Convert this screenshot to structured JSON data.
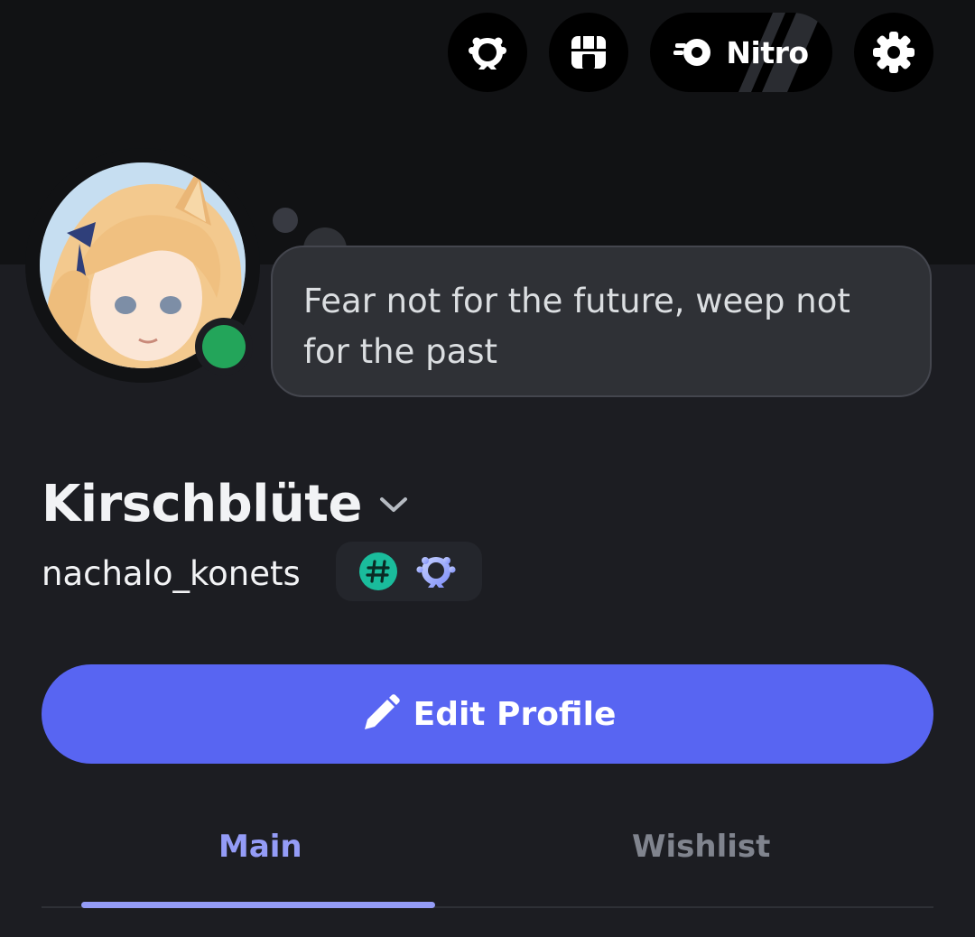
{
  "header": {
    "nitro_label": "Nitro"
  },
  "custom_status": {
    "text": "Fear not for the future, weep not for the past"
  },
  "profile": {
    "display_name": "Kirschblüte",
    "username": "nachalo_konets",
    "online_status": "online"
  },
  "actions": {
    "edit_profile_label": "Edit Profile"
  },
  "tabs": [
    {
      "label": "Main",
      "active": true
    },
    {
      "label": "Wishlist",
      "active": false
    }
  ],
  "icons": {
    "quests": "laurel-icon",
    "shop": "shop-icon",
    "nitro": "nitro-icon",
    "settings": "gear-icon",
    "display_name_menu": "chevron-down-icon",
    "badge_tag": "hashtag-badge-icon",
    "badge_quest": "laurel-badge-icon",
    "edit": "pencil-icon"
  },
  "colors": {
    "accent": "#5865f2",
    "tab_active": "#949cf7",
    "status_online": "#23a55a",
    "badge_tag": "#1abc9c",
    "badge_quest": "#a5b4fc"
  }
}
